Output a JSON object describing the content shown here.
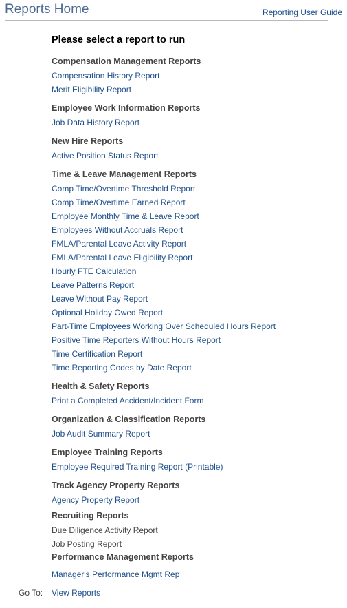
{
  "header": {
    "title": "Reports Home",
    "user_guide_link": "Reporting User Guide"
  },
  "prompt": "Please select a report to run",
  "sections": [
    {
      "heading": "Compensation Management Reports",
      "items": [
        {
          "label": "Compensation History Report",
          "link": true
        },
        {
          "label": "Merit Eligibility Report",
          "link": true
        }
      ]
    },
    {
      "heading": "Employee Work Information Reports",
      "items": [
        {
          "label": "Job Data History Report",
          "link": true
        }
      ]
    },
    {
      "heading": "New Hire Reports",
      "items": [
        {
          "label": "Active Position Status Report",
          "link": true
        }
      ]
    },
    {
      "heading": "Time & Leave Management Reports",
      "items": [
        {
          "label": "Comp Time/Overtime Threshold Report",
          "link": true
        },
        {
          "label": "Comp Time/Overtime Earned Report",
          "link": true
        },
        {
          "label": "Employee Monthly Time & Leave Report",
          "link": true
        },
        {
          "label": "Employees Without Accruals Report",
          "link": true
        },
        {
          "label": "FMLA/Parental Leave Activity Report",
          "link": true
        },
        {
          "label": "FMLA/Parental Leave Eligibility Report",
          "link": true
        },
        {
          "label": "Hourly FTE Calculation",
          "link": true
        },
        {
          "label": "Leave Patterns Report",
          "link": true
        },
        {
          "label": "Leave Without Pay Report",
          "link": true
        },
        {
          "label": "Optional Holiday Owed Report",
          "link": true
        },
        {
          "label": "Part-Time Employees Working Over Scheduled Hours Report",
          "link": true
        },
        {
          "label": "Positive Time Reporters Without Hours Report",
          "link": true
        },
        {
          "label": "Time Certification Report",
          "link": true
        },
        {
          "label": "Time Reporting Codes by Date Report",
          "link": true
        }
      ]
    },
    {
      "heading": "Health & Safety Reports",
      "items": [
        {
          "label": "Print a Completed Accident/Incident Form",
          "link": true
        }
      ]
    },
    {
      "heading": "Organization & Classification Reports",
      "items": [
        {
          "label": "Job Audit Summary Report",
          "link": true
        }
      ]
    },
    {
      "heading": "Employee Training Reports",
      "items": [
        {
          "label": "Employee Required Training Report (Printable)",
          "link": true
        }
      ]
    },
    {
      "heading": "Track Agency Property Reports",
      "items": [
        {
          "label": "Agency Property Report",
          "link": true
        }
      ]
    },
    {
      "heading": "Recruiting Reports",
      "items": [
        {
          "label": "Due Diligence Activity Report",
          "link": false
        },
        {
          "label": "Job Posting Report",
          "link": false
        }
      ]
    },
    {
      "heading": "Performance Management Reports",
      "items": [
        {
          "label": "Manager's Performance Mgmt Rep",
          "link": true
        }
      ]
    }
  ],
  "footer": {
    "goto_label": "Go To:",
    "goto_link": "View Reports"
  },
  "colors": {
    "title": "#4c6b94",
    "link": "#1f4f8b",
    "heading": "#444444",
    "rule": "#b8b8b8"
  }
}
